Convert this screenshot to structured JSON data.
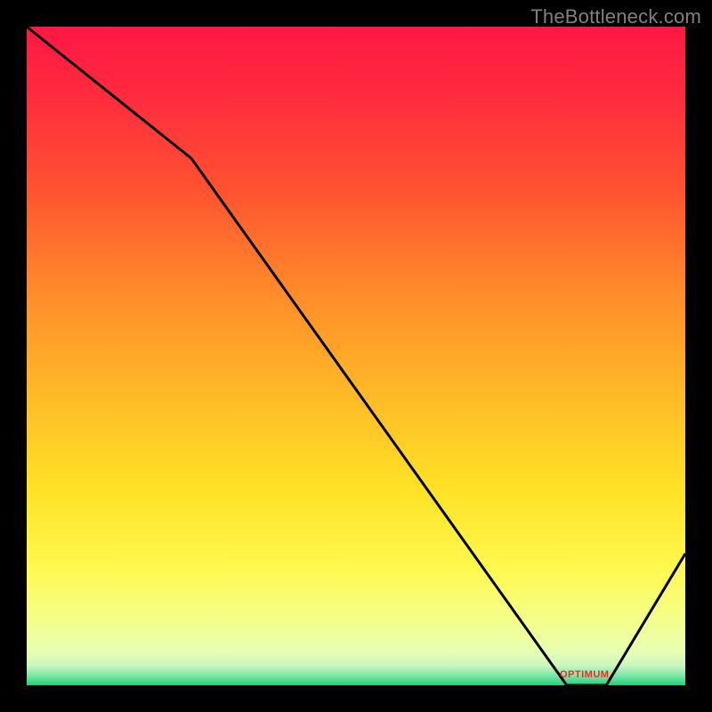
{
  "watermark": "TheBottleneck.com",
  "annotation_label": "OPTIMUM",
  "chart_data": {
    "type": "line",
    "title": "",
    "xlabel": "",
    "ylabel": "",
    "xlim": [
      0,
      100
    ],
    "ylim": [
      0,
      100
    ],
    "series": [
      {
        "name": "curve",
        "x": [
          0,
          25,
          82,
          88,
          100
        ],
        "y": [
          100,
          80,
          0,
          0,
          20
        ]
      }
    ],
    "optimum_range_x": [
      82,
      88
    ],
    "background_gradient_stops": [
      {
        "offset": 0.0,
        "color": "#ff1744"
      },
      {
        "offset": 0.1,
        "color": "#ff2a3f"
      },
      {
        "offset": 0.25,
        "color": "#ff5330"
      },
      {
        "offset": 0.4,
        "color": "#ff8a2a"
      },
      {
        "offset": 0.55,
        "color": "#ffb727"
      },
      {
        "offset": 0.7,
        "color": "#ffe126"
      },
      {
        "offset": 0.82,
        "color": "#fff84d"
      },
      {
        "offset": 0.9,
        "color": "#f4ff8a"
      },
      {
        "offset": 0.95,
        "color": "#e7ffb4"
      },
      {
        "offset": 0.97,
        "color": "#c9f7c1"
      },
      {
        "offset": 0.985,
        "color": "#7de8a8"
      },
      {
        "offset": 1.0,
        "color": "#1fd07a"
      }
    ]
  }
}
